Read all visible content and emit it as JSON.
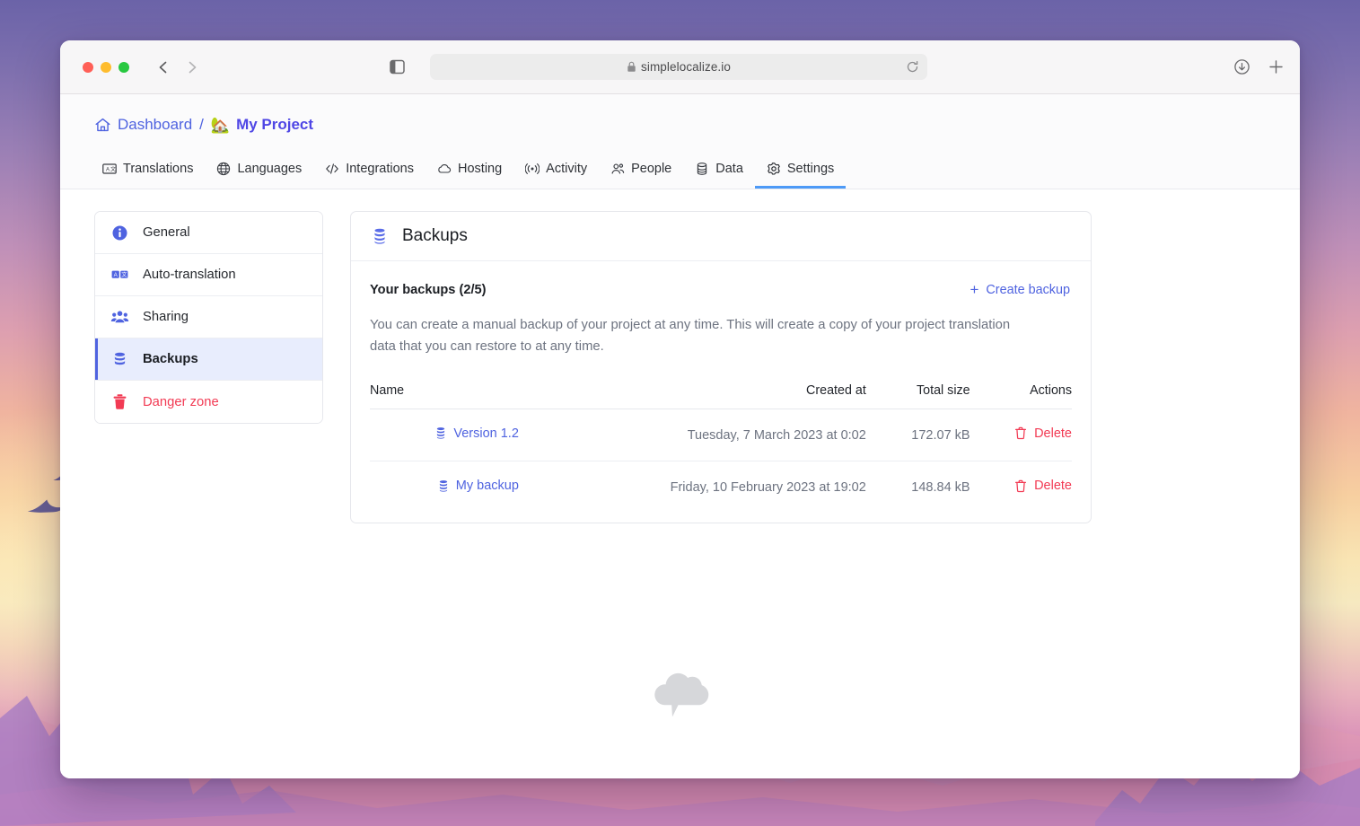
{
  "browser": {
    "url": "simplelocalize.io",
    "back_label": "Back",
    "forward_label": "Forward",
    "sidebar_toggle_label": "Sidebar",
    "reload_label": "Reload",
    "downloads_label": "Downloads",
    "new_tab_label": "New Tab"
  },
  "breadcrumb": {
    "home_label": "Dashboard",
    "separator": "/",
    "project_emoji": "🏡",
    "project_name": "My Project"
  },
  "tabs": [
    {
      "label": "Translations",
      "icon": "translate-icon",
      "active": false
    },
    {
      "label": "Languages",
      "icon": "globe-icon",
      "active": false
    },
    {
      "label": "Integrations",
      "icon": "code-icon",
      "active": false
    },
    {
      "label": "Hosting",
      "icon": "cloud-icon",
      "active": false
    },
    {
      "label": "Activity",
      "icon": "broadcast-icon",
      "active": false
    },
    {
      "label": "People",
      "icon": "people-icon",
      "active": false
    },
    {
      "label": "Data",
      "icon": "database-icon",
      "active": false
    },
    {
      "label": "Settings",
      "icon": "gear-icon",
      "active": true
    }
  ],
  "settings_menu": [
    {
      "label": "General",
      "icon": "info-icon",
      "active": false,
      "danger": false
    },
    {
      "label": "Auto-translation",
      "icon": "auto-translate-icon",
      "active": false,
      "danger": false
    },
    {
      "label": "Sharing",
      "icon": "people-group-icon",
      "active": false,
      "danger": false
    },
    {
      "label": "Backups",
      "icon": "database-icon",
      "active": true,
      "danger": false
    },
    {
      "label": "Danger zone",
      "icon": "trash-icon",
      "active": false,
      "danger": true
    }
  ],
  "card": {
    "title": "Backups",
    "subhead": "Your backups (2/5)",
    "create_label": "Create backup",
    "create_plus": "+",
    "description": "You can create a manual backup of your project at any time. This will create a copy of your project translation data that you can restore to at any time."
  },
  "table": {
    "columns": [
      "Name",
      "Created at",
      "Total size",
      "Actions"
    ],
    "rows": [
      {
        "name": "Version 1.2",
        "created_at": "Tuesday, 7 March 2023 at 0:02",
        "total_size": "172.07 kB",
        "action_label": "Delete"
      },
      {
        "name": "My backup",
        "created_at": "Friday, 10 February 2023 at 19:02",
        "total_size": "148.84 kB",
        "action_label": "Delete"
      }
    ]
  },
  "colors": {
    "accent": "#4f63e0",
    "danger": "#f23b54",
    "active_tab_underline": "#4d9af7",
    "active_menu_bg": "#e8edfd",
    "muted_text": "#6d7380"
  }
}
